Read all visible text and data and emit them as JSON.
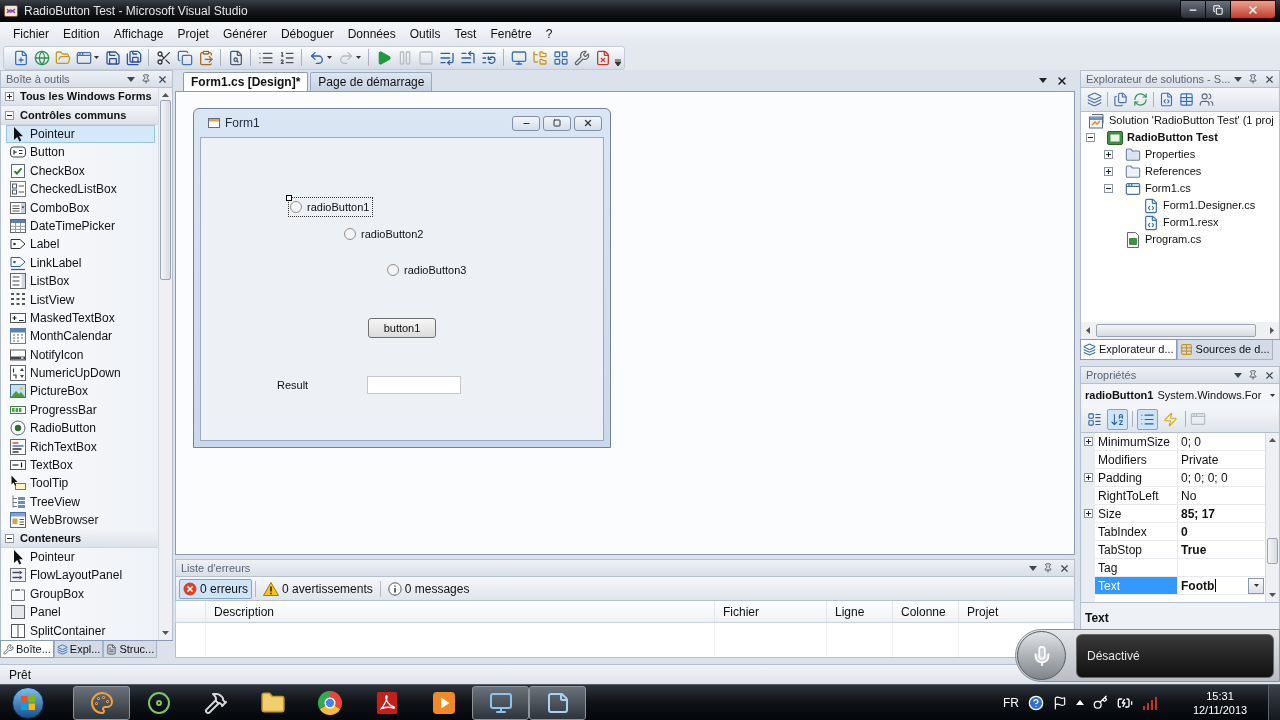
{
  "window": {
    "title": "RadioButton Test - Microsoft Visual Studio"
  },
  "menu": [
    "Fichier",
    "Edition",
    "Affichage",
    "Projet",
    "Générer",
    "Déboguer",
    "Données",
    "Outils",
    "Test",
    "Fenêtre",
    "?"
  ],
  "toolbar": [
    {
      "disabled": false
    },
    {
      "disabled": false
    },
    {
      "disabled": false
    },
    {
      "disabled": false
    },
    {
      "disabled": false
    },
    {
      "disabled": false
    },
    {
      "disabled": false
    },
    {
      "disabled": false
    },
    {
      "disabled": false
    },
    {
      "disabled": false
    },
    {
      "disabled": false
    },
    {
      "disabled": false
    },
    {
      "disabled": false
    },
    {
      "disabled": true
    },
    {
      "disabled": false
    },
    {
      "disabled": true
    },
    {
      "disabled": true
    },
    {
      "disabled": false
    },
    {
      "disabled": false
    },
    {
      "disabled": false
    },
    {
      "disabled": false
    },
    {
      "disabled": false
    },
    {
      "disabled": false
    },
    {
      "disabled": false
    },
    {
      "disabled": false
    }
  ],
  "toolbox": {
    "title": "Boîte à outils",
    "groups": [
      {
        "label": "Tous les Windows Forms",
        "expanded": false
      },
      {
        "label": "Contrôles communs",
        "expanded": true,
        "items": [
          {
            "label": "Pointeur",
            "selected": true
          },
          {
            "label": "Button",
            "selected": false
          },
          {
            "label": "CheckBox",
            "selected": false
          },
          {
            "label": "CheckedListBox",
            "selected": false
          },
          {
            "label": "ComboBox",
            "selected": false
          },
          {
            "label": "DateTimePicker",
            "selected": false
          },
          {
            "label": "Label",
            "selected": false
          },
          {
            "label": "LinkLabel",
            "selected": false
          },
          {
            "label": "ListBox",
            "selected": false
          },
          {
            "label": "ListView",
            "selected": false
          },
          {
            "label": "MaskedTextBox",
            "selected": false
          },
          {
            "label": "MonthCalendar",
            "selected": false
          },
          {
            "label": "NotifyIcon",
            "selected": false
          },
          {
            "label": "NumericUpDown",
            "selected": false
          },
          {
            "label": "PictureBox",
            "selected": false
          },
          {
            "label": "ProgressBar",
            "selected": false
          },
          {
            "label": "RadioButton",
            "selected": false
          },
          {
            "label": "RichTextBox",
            "selected": false
          },
          {
            "label": "TextBox",
            "selected": false
          },
          {
            "label": "ToolTip",
            "selected": false
          },
          {
            "label": "TreeView",
            "selected": false
          },
          {
            "label": "WebBrowser",
            "selected": false
          }
        ]
      },
      {
        "label": "Conteneurs",
        "expanded": true,
        "items": [
          {
            "label": "Pointeur",
            "selected": false
          },
          {
            "label": "FlowLayoutPanel",
            "selected": false
          },
          {
            "label": "GroupBox",
            "selected": false
          },
          {
            "label": "Panel",
            "selected": false
          },
          {
            "label": "SplitContainer",
            "selected": false
          }
        ]
      }
    ],
    "tabs": [
      {
        "label": "Boîte...",
        "selected": true
      },
      {
        "label": "Expl...",
        "selected": false
      },
      {
        "label": "Struc...",
        "selected": false
      }
    ]
  },
  "documents": {
    "tabs": [
      {
        "label": "Form1.cs [Design]*",
        "selected": true
      },
      {
        "label": "Page de démarrage",
        "selected": false
      }
    ],
    "form": {
      "title": "Form1",
      "controls": [
        {
          "kind": "radio",
          "label": "radioButton1",
          "checked": false,
          "selected": true
        },
        {
          "kind": "radio",
          "label": "radioButton2",
          "checked": false,
          "selected": false
        },
        {
          "kind": "radio",
          "label": "radioButton3",
          "checked": false,
          "selected": false
        },
        {
          "kind": "button",
          "label": "button1",
          "selected": false
        },
        {
          "kind": "label",
          "label": "Result",
          "selected": false
        },
        {
          "kind": "textbox",
          "selected": false
        }
      ]
    }
  },
  "error_list": {
    "title": "Liste d'erreurs",
    "filters": [
      {
        "label": "0 erreurs",
        "selected": true
      },
      {
        "label": "0 avertissements",
        "selected": false
      },
      {
        "label": "0 messages",
        "selected": false
      }
    ],
    "columns": [
      "Description",
      "Fichier",
      "Ligne",
      "Colonne",
      "Projet"
    ]
  },
  "solution_explorer": {
    "title": "Explorateur de solutions - S...",
    "tree": [
      {
        "label": "Solution 'RadioButton Test' (1 proj",
        "kind": "solution",
        "children": [
          {
            "label": "RadioButton Test",
            "kind": "project",
            "startup": true,
            "expanded": true,
            "children": [
              {
                "label": "Properties",
                "kind": "folder",
                "expanded": false
              },
              {
                "label": "References",
                "kind": "references",
                "expanded": false
              },
              {
                "label": "Form1.cs",
                "kind": "form",
                "expanded": true,
                "children": [
                  {
                    "label": "Form1.Designer.cs",
                    "kind": "code"
                  },
                  {
                    "label": "Form1.resx",
                    "kind": "code"
                  }
                ]
              },
              {
                "label": "Program.cs",
                "kind": "class"
              }
            ]
          }
        ]
      }
    ],
    "tabs": [
      {
        "label": "Explorateur d...",
        "selected": true
      },
      {
        "label": "Sources de d...",
        "selected": false
      }
    ]
  },
  "properties": {
    "title": "Propriétés",
    "object": {
      "name": "radioButton1",
      "type": "System.Windows.For"
    },
    "view_buttons": [
      {
        "selected": false
      },
      {
        "selected": true
      },
      {
        "selected": true
      },
      {
        "selected": false
      }
    ],
    "property_pages": {
      "disabled": true
    },
    "rows": [
      {
        "name": "MinimumSize",
        "value": "0; 0",
        "expanded": false,
        "modified": false,
        "selected": false
      },
      {
        "name": "Modifiers",
        "value": "Private",
        "modified": false,
        "selected": false
      },
      {
        "name": "Padding",
        "value": "0; 0; 0; 0",
        "expanded": false,
        "modified": false,
        "selected": false
      },
      {
        "name": "RightToLeft",
        "value": "No",
        "modified": false,
        "selected": false
      },
      {
        "name": "Size",
        "value": "85; 17",
        "expanded": false,
        "modified": true,
        "selected": false
      },
      {
        "name": "TabIndex",
        "value": "0",
        "modified": true,
        "selected": false
      },
      {
        "name": "TabStop",
        "value": "True",
        "modified": true,
        "selected": false
      },
      {
        "name": "Tag",
        "selected": false
      },
      {
        "name": "Text",
        "value": "Footb",
        "modified": true,
        "selected": true
      }
    ],
    "description_title": "Text"
  },
  "speech": {
    "status": "Désactivé"
  },
  "status_bar": {
    "text": "Prêt"
  },
  "taskbar": {
    "apps": [
      {
        "running": true
      },
      {
        "running": false
      },
      {
        "running": false
      },
      {
        "running": false
      },
      {
        "running": false
      },
      {
        "running": false
      },
      {
        "running": false
      },
      {
        "running": true
      },
      {
        "running": true
      }
    ],
    "tray": {
      "language": "FR",
      "time": "15:31",
      "date": "12/11/2013"
    }
  }
}
